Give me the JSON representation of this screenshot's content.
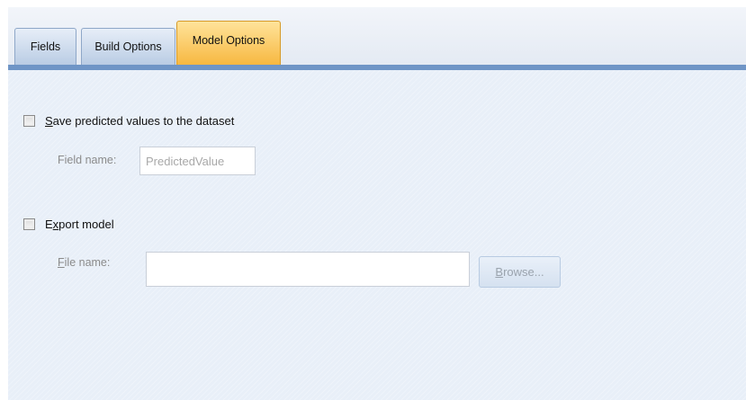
{
  "tabs": {
    "fields": "Fields",
    "build_options": "Build Options",
    "model_options": "Model Options",
    "active": "Model Options"
  },
  "save_predicted": {
    "label_accel": "S",
    "label_rest": "ave predicted values to the dataset",
    "checked": false,
    "field_name_label": "Field name:",
    "field_name_value": "PredictedValue"
  },
  "export_model": {
    "label_pre": "E",
    "label_accel": "x",
    "label_rest": "port model",
    "checked": false,
    "file_name_label_accel": "F",
    "file_name_label_rest": "ile name:",
    "file_name_value": "",
    "browse_accel": "B",
    "browse_rest": "rowse..."
  },
  "colors": {
    "active_tab": "#f7b841",
    "tab_underline": "#6f95c6",
    "panel_background": "#e8eff8"
  }
}
